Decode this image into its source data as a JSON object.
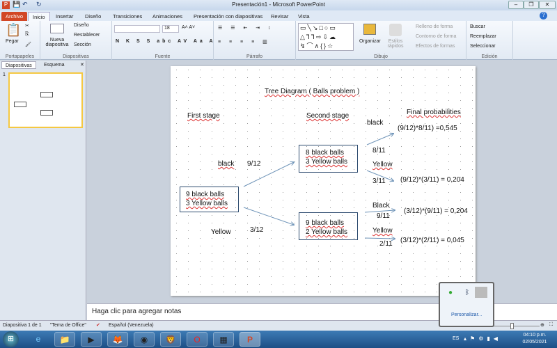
{
  "window": {
    "title": "Presentación1 - Microsoft PowerPoint"
  },
  "tabs": [
    "Archivo",
    "Inicio",
    "Insertar",
    "Diseño",
    "Transiciones",
    "Animaciones",
    "Presentación con diapositivas",
    "Revisar",
    "Vista"
  ],
  "ribbon": {
    "portapapeles": {
      "paste": "Pegar",
      "label": "Portapapeles"
    },
    "diapositivas": {
      "new": "Nueva diapositiva",
      "layout": "Diseño",
      "reset": "Restablecer",
      "section": "Sección",
      "label": "Diapositivas"
    },
    "fuente": {
      "size": "18",
      "label": "Fuente"
    },
    "parrafo": {
      "label": "Párrafo"
    },
    "dibujo": {
      "arrange": "Organizar",
      "styles": "Estilos rápidos",
      "fill": "Relleno de forma",
      "outline": "Contorno de forma",
      "effects": "Efectos de formas",
      "label": "Dibujo"
    },
    "edicion": {
      "find": "Buscar",
      "replace": "Reemplazar",
      "select": "Seleccionar",
      "label": "Edición"
    }
  },
  "leftpane": {
    "tabs": [
      "Diapositivas",
      "Esquema"
    ],
    "slide_number": "1"
  },
  "slide": {
    "title": "Tree Diagram ( Balls problem )",
    "first_stage": "First stage",
    "second_stage": "Second stage",
    "final": "Final probabilities",
    "box1": [
      "9 black balls",
      "3 Yellow balls"
    ],
    "box2": [
      "8 black balls",
      "3 Yellow balls"
    ],
    "box3": [
      "9 black balls",
      "2 Yellow balls"
    ],
    "b1_label": "black",
    "b1_prob": "9/12",
    "y1_label": "Yellow",
    "y1_prob": "3/12",
    "bb_label": "black",
    "bb_prob": "8/11",
    "by_label": "Yellow",
    "by_prob": "3/11",
    "yb_label": "Black",
    "yb_prob": "9/11",
    "yy_label": "Yellow",
    "yy_prob": "2/11",
    "f1": "(9/12)*8/11)  =0,545",
    "f2": "(9/12)*(3/11) = 0,204",
    "f3": "(3/12)*(9/11) = 0,204",
    "f4": "(3/12)*(2/11) = 0,045"
  },
  "notes": {
    "placeholder": "Haga clic para agregar notas"
  },
  "status": {
    "slide": "Diapositiva 1 de 1",
    "theme": "\"Tema de Office\"",
    "language": "Español (Venezuela)"
  },
  "tray": {
    "customize": "Personalizar...",
    "lang": "ES",
    "time": "04:10 p.m.",
    "date": "02/05/2021"
  }
}
